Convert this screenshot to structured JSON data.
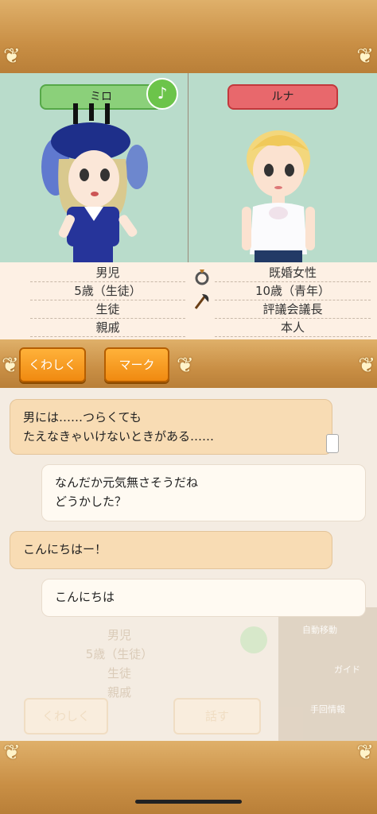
{
  "characters": {
    "left": {
      "name": "ミロ",
      "info": [
        "男児",
        "5歳（生徒）",
        "生徒",
        "親戚"
      ]
    },
    "right": {
      "name": "ルナ",
      "info": [
        "既婚女性",
        "10歳（青年）",
        "評議会議長",
        "本人"
      ]
    }
  },
  "icons": {
    "music": "♪",
    "ring": "ring-icon",
    "axe": "axe-icon"
  },
  "buttons": {
    "details": "くわしく",
    "mark": "マーク"
  },
  "messages": [
    {
      "side": "left",
      "text": "男には……つらくても\nたえなきゃいけないときがある……"
    },
    {
      "side": "right",
      "text": "なんだか元気無さそうだね\nどうかした？"
    },
    {
      "side": "left",
      "text": "こんにちはー！"
    },
    {
      "side": "right",
      "text": "こんにちは"
    }
  ],
  "background_ghost": {
    "info": [
      "男児",
      "5歳（生徒）",
      "生徒",
      "親戚"
    ],
    "buttons": [
      "くわしく",
      "話す"
    ],
    "menu": [
      "自動移動",
      "ガイド",
      "手回情報"
    ]
  },
  "colors": {
    "wood": "#c98f45",
    "panel_bg": "#b9dccb",
    "left_tag": "#8bd07a",
    "right_tag": "#e8686c",
    "button": "#f08a10"
  }
}
